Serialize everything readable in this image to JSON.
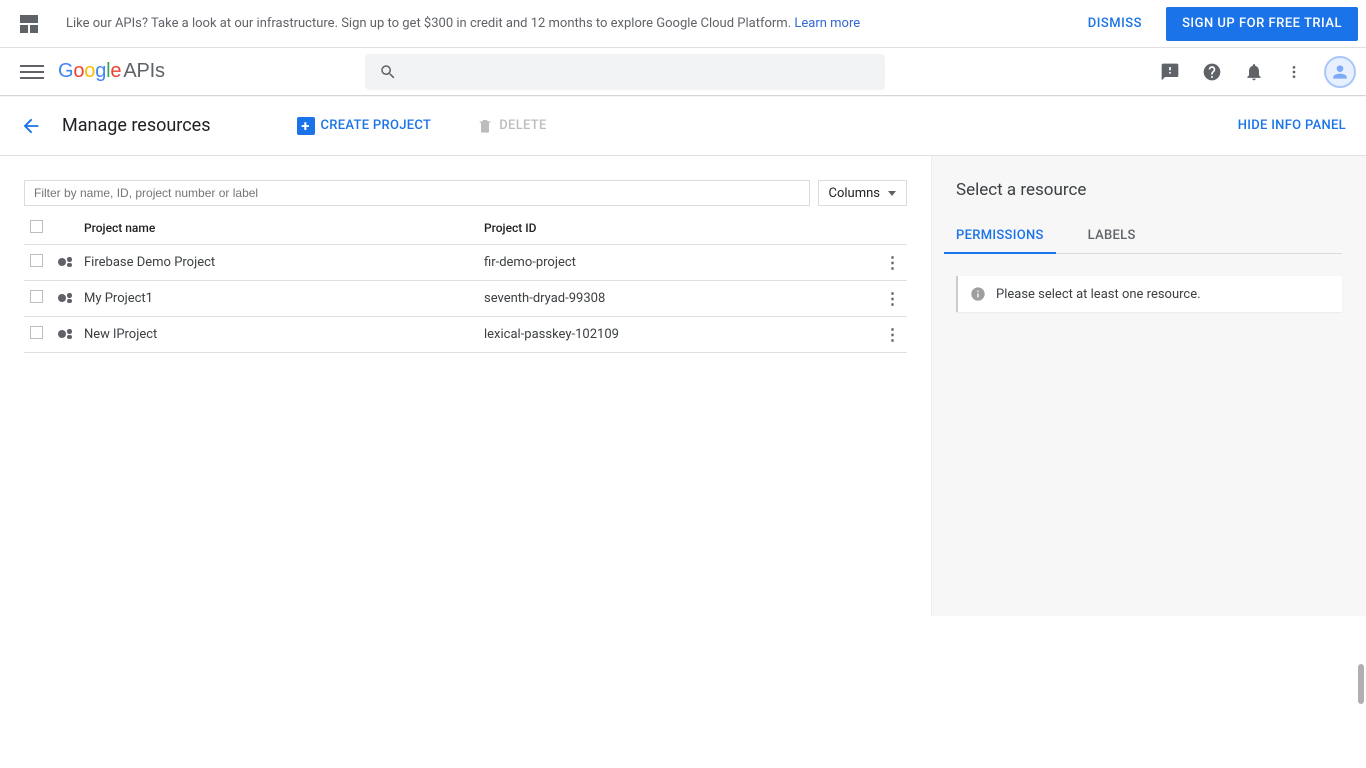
{
  "promo": {
    "text": "Like our APIs? Take a look at our infrastructure. Sign up to get $300 in credit and 12 months to explore Google Cloud Platform. ",
    "link": "Learn more",
    "dismiss": "DISMISS",
    "signup": "SIGN UP FOR FREE TRIAL"
  },
  "logo_suffix": "APIs",
  "search": {
    "placeholder": ""
  },
  "page": {
    "title": "Manage resources",
    "create": "CREATE PROJECT",
    "delete": "DELETE",
    "hide_panel": "HIDE INFO PANEL"
  },
  "filter": {
    "placeholder": "Filter by name, ID, project number or label"
  },
  "columns_btn": "Columns",
  "table": {
    "headers": {
      "name": "Project name",
      "id": "Project ID"
    },
    "rows": [
      {
        "name": "Firebase Demo Project",
        "id": "fir-demo-project"
      },
      {
        "name": "My Project1",
        "id": "seventh-dryad-99308"
      },
      {
        "name": "New lProject",
        "id": "lexical-passkey-102109"
      }
    ]
  },
  "side": {
    "title": "Select a resource",
    "tabs": {
      "permissions": "PERMISSIONS",
      "labels": "LABELS"
    },
    "info": "Please select at least one resource."
  }
}
